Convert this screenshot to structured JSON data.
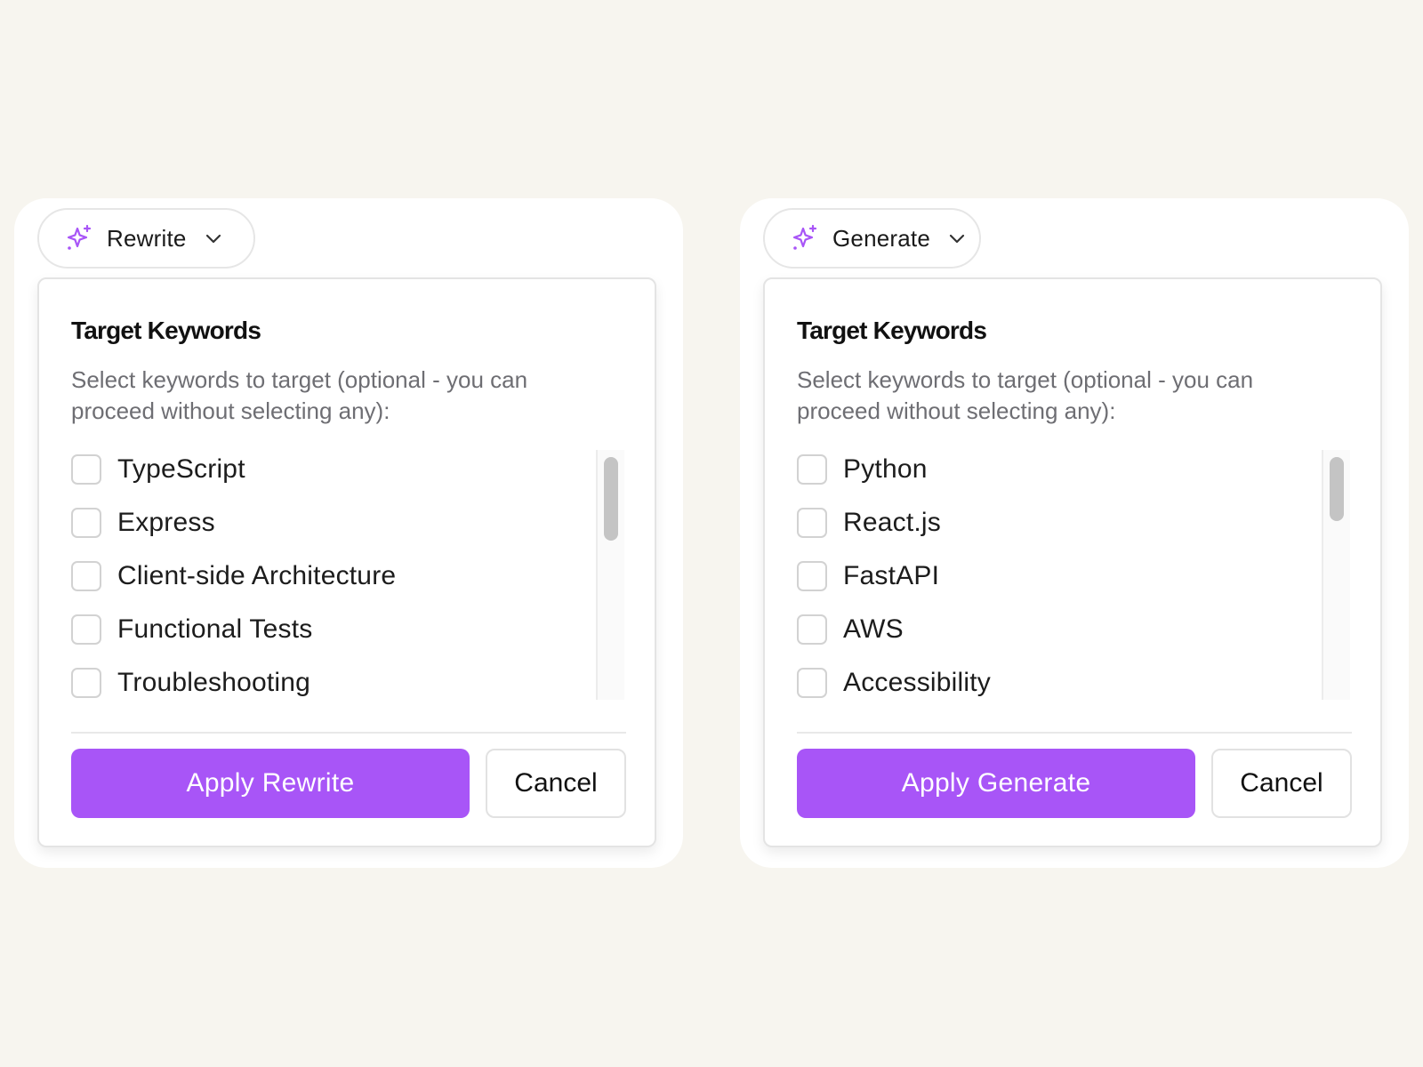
{
  "colors": {
    "accent": "#a855f7",
    "background": "#f7f5ef",
    "panel": "#ffffff"
  },
  "panels": [
    {
      "mode_label": "Rewrite",
      "mode_icon": "sparkle-icon",
      "title": "Target Keywords",
      "description": "Select keywords to target (optional - you can proceed without selecting any):",
      "keywords": [
        {
          "label": "TypeScript",
          "checked": false
        },
        {
          "label": "Express",
          "checked": false
        },
        {
          "label": "Client-side Architecture",
          "checked": false
        },
        {
          "label": "Functional Tests",
          "checked": false
        },
        {
          "label": "Troubleshooting",
          "checked": false
        }
      ],
      "apply_label": "Apply Rewrite",
      "cancel_label": "Cancel"
    },
    {
      "mode_label": "Generate",
      "mode_icon": "sparkle-icon",
      "title": "Target Keywords",
      "description": "Select keywords to target (optional - you can proceed without selecting any):",
      "keywords": [
        {
          "label": "Python",
          "checked": false
        },
        {
          "label": "React.js",
          "checked": false
        },
        {
          "label": "FastAPI",
          "checked": false
        },
        {
          "label": "AWS",
          "checked": false
        },
        {
          "label": "Accessibility",
          "checked": false
        }
      ],
      "apply_label": "Apply Generate",
      "cancel_label": "Cancel"
    }
  ]
}
